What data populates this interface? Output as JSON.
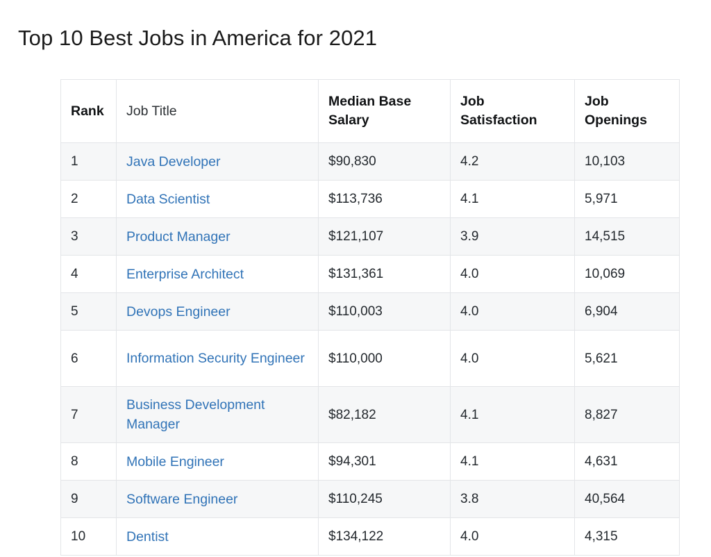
{
  "page": {
    "title": "Top 10 Best Jobs in America for 2021"
  },
  "colors": {
    "link": "#3073b7",
    "text": "#23282d",
    "row_stripe": "#f6f7f8",
    "border": "#e3e5e8"
  },
  "table": {
    "columns": [
      {
        "key": "rank",
        "label": "Rank",
        "bold": true
      },
      {
        "key": "job_title",
        "label": "Job Title",
        "bold": false
      },
      {
        "key": "median_base_salary",
        "label": "Median Base Salary",
        "bold": true
      },
      {
        "key": "job_satisfaction",
        "label": "Job Satisfaction",
        "bold": true
      },
      {
        "key": "job_openings",
        "label": "Job Openings",
        "bold": true
      }
    ],
    "rows": [
      {
        "rank": "1",
        "job_title": "Java Developer",
        "median_base_salary": "$90,830",
        "job_satisfaction": "4.2",
        "job_openings": "10,103"
      },
      {
        "rank": "2",
        "job_title": "Data Scientist",
        "median_base_salary": "$113,736",
        "job_satisfaction": "4.1",
        "job_openings": "5,971"
      },
      {
        "rank": "3",
        "job_title": "Product Manager",
        "median_base_salary": "$121,107",
        "job_satisfaction": "3.9",
        "job_openings": "14,515"
      },
      {
        "rank": "4",
        "job_title": "Enterprise Architect",
        "median_base_salary": "$131,361",
        "job_satisfaction": "4.0",
        "job_openings": "10,069"
      },
      {
        "rank": "5",
        "job_title": "Devops Engineer",
        "median_base_salary": "$110,003",
        "job_satisfaction": "4.0",
        "job_openings": "6,904"
      },
      {
        "rank": "6",
        "job_title": "Information Security Engineer",
        "median_base_salary": "$110,000",
        "job_satisfaction": "4.0",
        "job_openings": "5,621"
      },
      {
        "rank": "7",
        "job_title": "Business Development Manager",
        "median_base_salary": "$82,182",
        "job_satisfaction": "4.1",
        "job_openings": "8,827"
      },
      {
        "rank": "8",
        "job_title": "Mobile Engineer",
        "median_base_salary": "$94,301",
        "job_satisfaction": "4.1",
        "job_openings": "4,631"
      },
      {
        "rank": "9",
        "job_title": "Software Engineer",
        "median_base_salary": "$110,245",
        "job_satisfaction": "3.8",
        "job_openings": "40,564"
      },
      {
        "rank": "10",
        "job_title": "Dentist",
        "median_base_salary": "$134,122",
        "job_satisfaction": "4.0",
        "job_openings": "4,315"
      }
    ]
  }
}
